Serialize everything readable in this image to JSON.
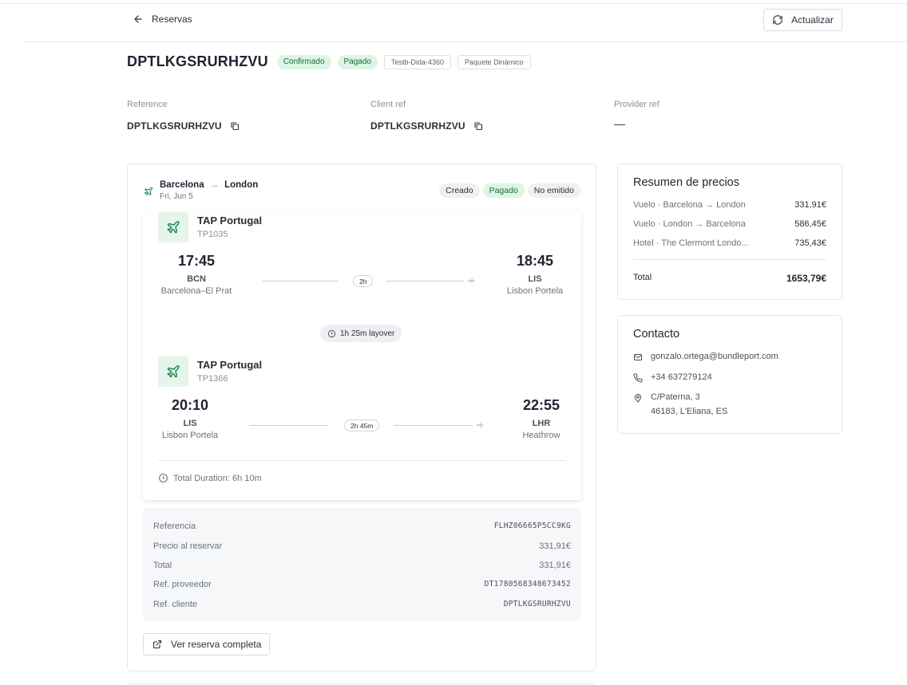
{
  "header": {
    "back_label": "Reservas",
    "refresh_label": "Actualizar"
  },
  "booking": {
    "code": "DPTLKGSRURHZVU",
    "badges": [
      "Confirmado",
      "Pagado",
      "Testb-Dida-4360",
      "Paquete Dinámico"
    ]
  },
  "refs": {
    "reference_label": "Reference",
    "reference_value": "DPTLKGSRURHZVU",
    "client_label": "Client ref",
    "client_value": "DPTLKGSRURHZVU",
    "provider_label": "Provider ref",
    "provider_value": "—"
  },
  "flight": {
    "origin": "Barcelona",
    "destination": "London",
    "date": "Fri, Jun 5",
    "statuses": [
      "Creado",
      "Pagado",
      "No emitido"
    ],
    "segments": [
      {
        "airline": "TAP Portugal",
        "flight_no": "TP1035",
        "dep_time": "17:45",
        "dep_code": "BCN",
        "dep_airport": "Barcelona–El Prat",
        "duration": "2h",
        "arr_time": "18:45",
        "arr_code": "LIS",
        "arr_airport": "Lisbon Portela"
      },
      {
        "airline": "TAP Portugal",
        "flight_no": "TP1366",
        "dep_time": "20:10",
        "dep_code": "LIS",
        "dep_airport": "Lisbon Portela",
        "duration": "2h 45m",
        "arr_time": "22:55",
        "arr_code": "LHR",
        "arr_airport": "Heathrow"
      }
    ],
    "layover": "1h 25m layover",
    "total_duration": "Total Duration: 6h 10m",
    "details": {
      "referencia_label": "Referencia",
      "referencia_value": "FLHZ06665P5CC9KG",
      "precio_label": "Precio al reservar",
      "precio_value": "331,91€",
      "total_label": "Total",
      "total_value": "331,91€",
      "prov_label": "Ref. proveedor",
      "prov_value": "DT1780568348673452",
      "cliente_label": "Ref. cliente",
      "cliente_value": "DPTLKGSRURHZVU"
    },
    "view_button": "Ver reserva completa"
  },
  "pricing": {
    "title": "Resumen de precios",
    "items": [
      {
        "label": "Vuelo · Barcelona → London",
        "value": "331,91€"
      },
      {
        "label": "Vuelo · London → Barcelona",
        "value": "586,45€"
      },
      {
        "label": "Hotel · The Clermont Londo...",
        "value": "735,43€"
      }
    ],
    "total_label": "Total",
    "total_value": "1653,79€"
  },
  "contact": {
    "title": "Contacto",
    "email": "gonzalo.ortega@bundleport.com",
    "phone": "+34 637279124",
    "address_line1": "C/Paterna, 3",
    "address_line2": "46183, L'Eliana, ES"
  },
  "colors": {
    "accent_green": "#1e8a4a",
    "badge_green_bg": "#dcf5e4",
    "neutral_pill_bg": "#eef0f3"
  }
}
